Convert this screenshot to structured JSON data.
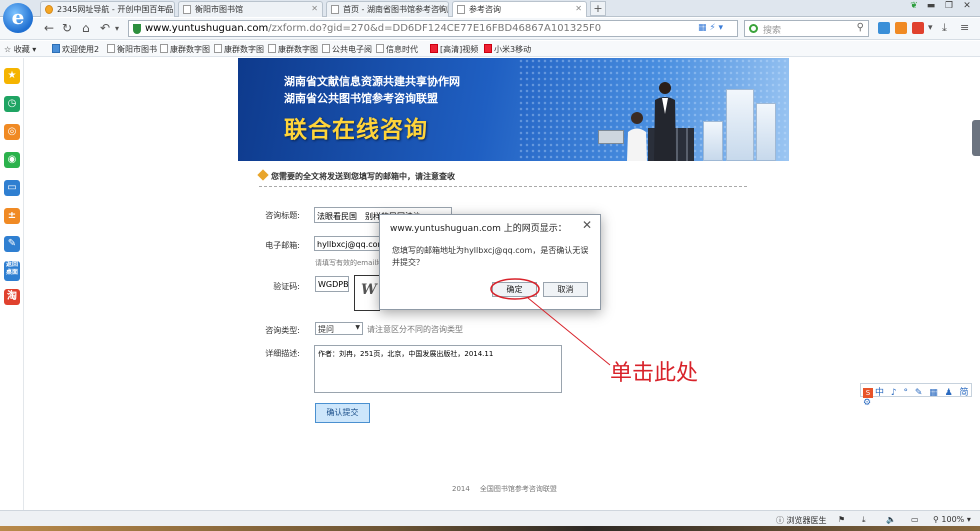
{
  "browser": {
    "tabs": [
      {
        "label": "2345网址导航 - 开创中国百年品"
      },
      {
        "label": "衡阳市图书馆"
      },
      {
        "label": "首页 - 湖南省图书馆参考咨询服"
      },
      {
        "label": "参考咨询"
      }
    ],
    "address": {
      "host": "www.yuntushuguan.com",
      "path": "/zxform.do?gid=270&d=DD6DF124CE77E16FBD46867A101325F0"
    },
    "search_placeholder": "搜索",
    "new_tab": "+"
  },
  "bookmarks": [
    {
      "label": "收藏"
    },
    {
      "label": "欢迎使用2"
    },
    {
      "label": "衡阳市图书"
    },
    {
      "label": "康群数字图"
    },
    {
      "label": "康群数字图"
    },
    {
      "label": "康群数字图"
    },
    {
      "label": "公共电子阅"
    },
    {
      "label": "信息时代"
    },
    {
      "label": "[高清]视频"
    },
    {
      "label": "小米3移动"
    }
  ],
  "sidebar": [
    "star",
    "clock",
    "weibo",
    "wechat",
    "monitor",
    "calculator",
    "notebook",
    "desktop",
    "taobao"
  ],
  "sidebar_desktop_label": "返回桌面",
  "sidebar_taobao_label": "淘",
  "banner": {
    "line1": "湖南省文献信息资源共建共享协作网",
    "line2": "湖南省公共图书馆参考咨询联盟",
    "line3": "联合在线咨询"
  },
  "form": {
    "notice": "您需要的全文将发送到您填写的邮箱中，请注意查收",
    "title_label": "咨询标题:",
    "title_value": "法眼看民国　别样的民国法治",
    "email_label": "电子邮箱:",
    "email_value": "hyllbxcj@qq.com",
    "email_hint": "请填写有效的email地",
    "captcha_label": "验证码:",
    "captcha_value": "WGDPB",
    "captcha_image_text": "W",
    "type_label": "咨询类型:",
    "type_value": "提问",
    "type_hint": "请注意区分不同的咨询类型",
    "desc_label": "详细描述:",
    "desc_value": "作者：刘冉，251页，北京，中国发展出版社，2014.11",
    "submit_label": "确认提交"
  },
  "footer": {
    "year": "2014",
    "org": "全国图书馆参考咨询联盟"
  },
  "dialog": {
    "title": "www.yuntushuguan.com 上的网页显示：",
    "message": "您填写的邮箱地址为hyllbxcj@qq.com，是否确认无误并提交？",
    "ok_label": "确定",
    "cancel_label": "取消",
    "close": "✕"
  },
  "annotation": {
    "text": "单击此处",
    "color": "#d8222a"
  },
  "ime": {
    "icon": "S",
    "text": "中 ♪ ° ✎ ▦ ♟ 简 ⚙"
  },
  "statusbar": {
    "doctor": "浏览器医生",
    "zoom": "100%"
  },
  "window_controls": [
    "▬",
    "❐",
    "✕"
  ]
}
